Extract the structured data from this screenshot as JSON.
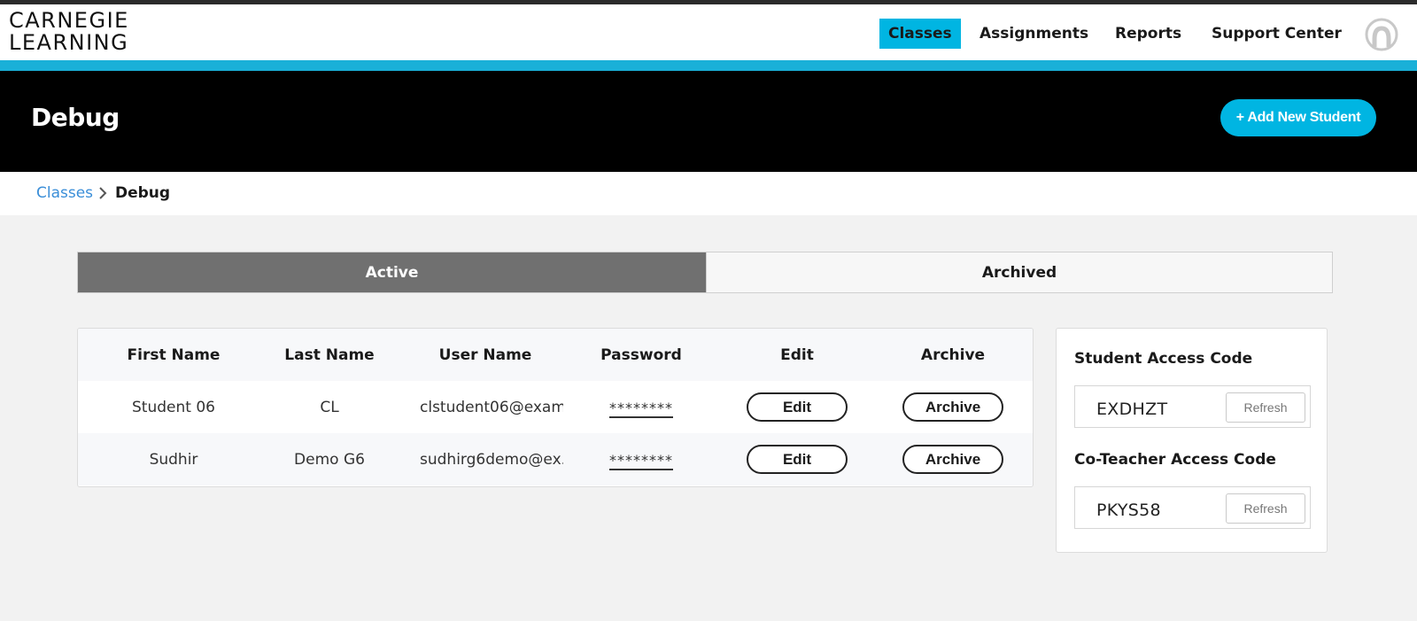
{
  "header": {
    "logo_line1": "CARNEGIE",
    "logo_line2": "LEARNING",
    "nav": [
      {
        "label": "Classes"
      },
      {
        "label": "Assignments"
      },
      {
        "label": "Reports"
      },
      {
        "label": "Support Center"
      }
    ],
    "avatar_icon": "user-avatar-icon",
    "accent_color": "#00b5e2"
  },
  "banner": {
    "title": "Debug",
    "add_button": "+ Add New Student"
  },
  "breadcrumb": {
    "parent": "Classes",
    "current": "Debug"
  },
  "tabs": [
    {
      "label": "Active",
      "selected": true
    },
    {
      "label": "Archived",
      "selected": false
    }
  ],
  "table": {
    "headers": [
      "First Name",
      "Last Name",
      "User Name",
      "Password",
      "Edit",
      "Archive"
    ],
    "rows": [
      {
        "first": "Student 06",
        "last": "CL",
        "user": "clstudent06@exam...",
        "password": "********",
        "edit": "Edit",
        "archive": "Archive"
      },
      {
        "first": "Sudhir",
        "last": "Demo G6",
        "user": "sudhirg6demo@ex...",
        "password": "********",
        "edit": "Edit",
        "archive": "Archive"
      }
    ]
  },
  "codes": {
    "student_label": "Student Access Code",
    "student_code": "EXDHZT",
    "coteacher_label": "Co-Teacher Access Code",
    "coteacher_code": "PKYS58",
    "refresh_label": "Refresh"
  }
}
